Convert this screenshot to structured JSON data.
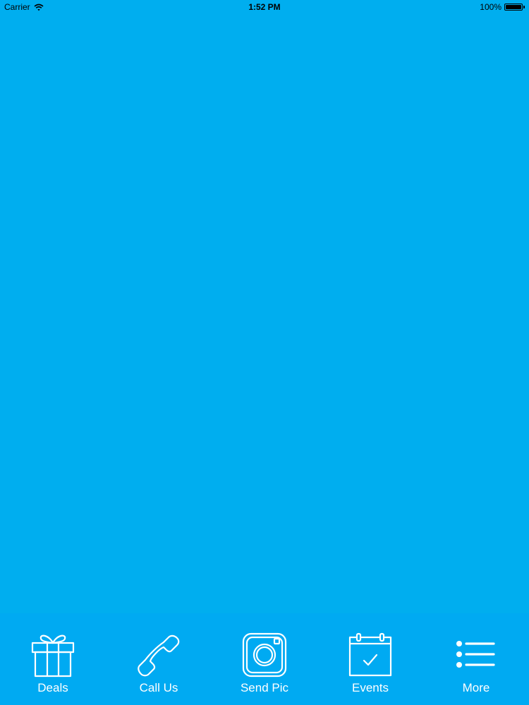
{
  "status_bar": {
    "carrier": "Carrier",
    "time": "1:52 PM",
    "battery": "100%"
  },
  "colors": {
    "background": "#00AEEF",
    "tab_bar": "#00AAF2",
    "icon": "#FFFFFF"
  },
  "tab_bar": {
    "items": [
      {
        "label": "Deals",
        "icon": "gift-icon"
      },
      {
        "label": "Call Us",
        "icon": "phone-icon"
      },
      {
        "label": "Send Pic",
        "icon": "camera-icon"
      },
      {
        "label": "Events",
        "icon": "calendar-check-icon"
      },
      {
        "label": "More",
        "icon": "list-icon"
      }
    ]
  }
}
